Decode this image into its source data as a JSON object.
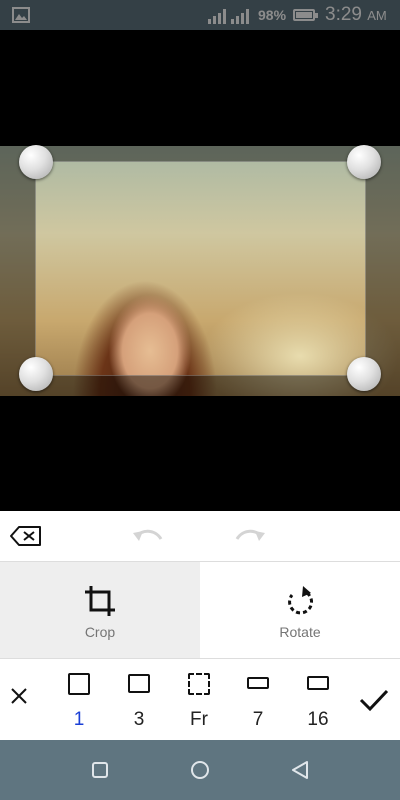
{
  "status_bar": {
    "battery_percent": "98%",
    "battery_level": 0.98,
    "time": "3:29",
    "ampm": "AM",
    "icons": [
      "image-notification-icon",
      "signal-icon",
      "signal-icon",
      "battery-icon"
    ]
  },
  "editor": {
    "toolbar": {
      "icons": [
        "backspace-icon",
        "undo-icon",
        "redo-icon"
      ]
    },
    "modes": [
      {
        "label": "Crop",
        "icon": "crop-icon",
        "selected": true
      },
      {
        "label": "Rotate",
        "icon": "rotate-icon",
        "selected": false
      }
    ],
    "ratios": [
      {
        "label": "1",
        "icon": "square-ratio-icon",
        "selected": true
      },
      {
        "label": "3",
        "icon": "landscape-ratio-icon",
        "selected": false
      },
      {
        "label": "Fr",
        "icon": "freeform-ratio-icon",
        "selected": false
      },
      {
        "label": "7",
        "icon": "wide-ratio-icon",
        "selected": false
      },
      {
        "label": "16",
        "icon": "widescreen-ratio-icon",
        "selected": false
      }
    ],
    "colors": {
      "selected_ratio": "#1a3fd6",
      "system_bars": "#5f7580",
      "active_tab_bg": "#eeeeee"
    }
  },
  "nav_bar": {
    "icons": [
      "recents-icon",
      "home-icon",
      "back-icon"
    ]
  }
}
